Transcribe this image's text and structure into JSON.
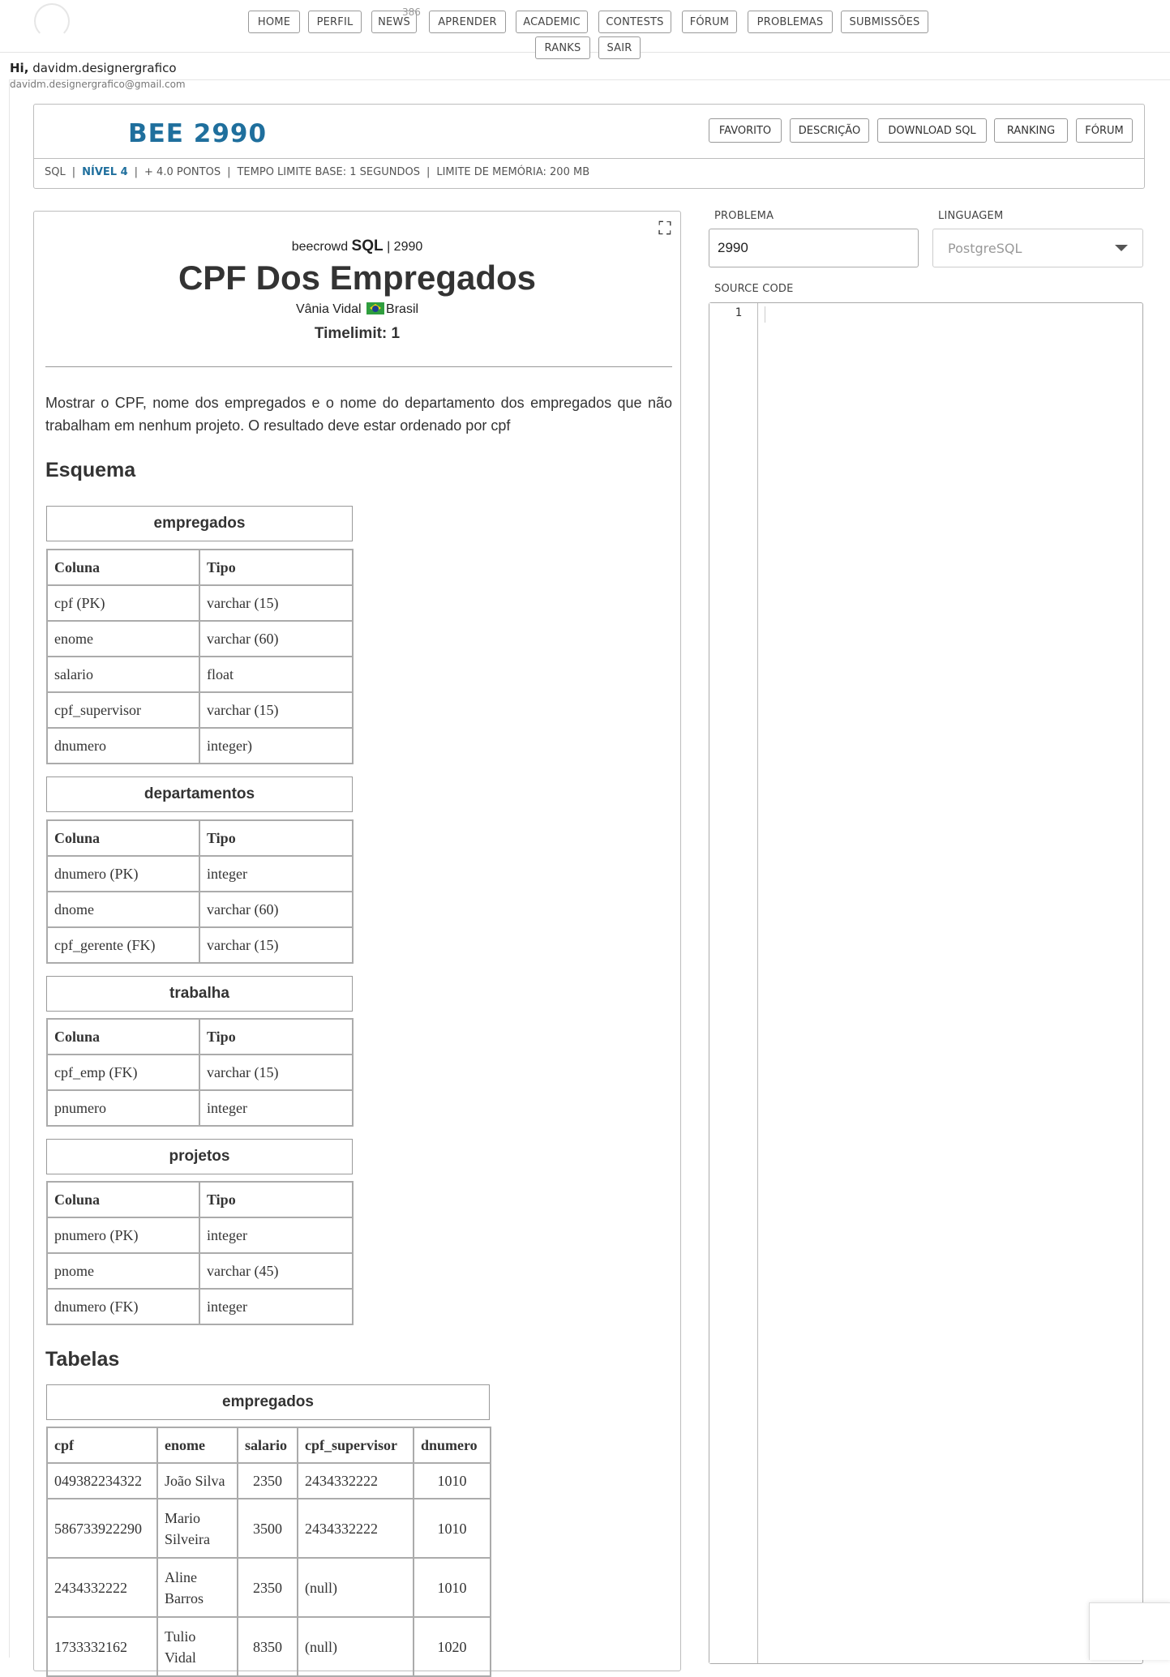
{
  "nav": {
    "items": [
      "HOME",
      "PERFIL",
      "NEWS",
      "APRENDER",
      "ACADEMIC",
      "CONTESTS",
      "FÓRUM",
      "PROBLEMAS",
      "SUBMISSÕES",
      "RANKS",
      "SAIR"
    ],
    "news_count": "386"
  },
  "user": {
    "greeting": "Hi,",
    "name": "davidm.designergrafico",
    "email": "davidm.designergrafico@gmail.com"
  },
  "header": {
    "title": "BEE 2990",
    "buttons": [
      "FAVORITO",
      "DESCRIÇÃO",
      "DOWNLOAD SQL",
      "RANKING",
      "FÓRUM"
    ],
    "meta": {
      "category": "SQL",
      "level": "NÍVEL 4",
      "points": "+ 4.0 PONTOS",
      "timelimit": "TEMPO LIMITE BASE: 1 SEGUNDOS",
      "memory": "LIMITE DE MEMÓRIA: 200 MB"
    }
  },
  "problem": {
    "source_prefix": "beecrowd",
    "source_cat": "SQL",
    "source_num": "| 2990",
    "title": "CPF Dos Empregados",
    "author": "Vânia Vidal",
    "country": "Brasil",
    "timelimit": "Timelimit: 1",
    "description": "Mostrar o CPF, nome dos empregados e o nome do departamento dos empregados que não trabalham em nenhum projeto. O resultado deve estar ordenado por cpf",
    "schema_heading": "Esquema",
    "tables_heading": "Tabelas",
    "schema_tables": [
      {
        "name": "empregados",
        "header": [
          "Coluna",
          "Tipo"
        ],
        "rows": [
          [
            "cpf (PK)",
            "varchar (15)"
          ],
          [
            "enome",
            "varchar (60)"
          ],
          [
            "salario",
            "float"
          ],
          [
            "cpf_supervisor",
            "varchar (15)"
          ],
          [
            "dnumero",
            "integer)"
          ]
        ]
      },
      {
        "name": "departamentos",
        "header": [
          "Coluna",
          "Tipo"
        ],
        "rows": [
          [
            "dnumero (PK)",
            "integer"
          ],
          [
            "dnome",
            "varchar (60)"
          ],
          [
            "cpf_gerente (FK)",
            "varchar (15)"
          ]
        ]
      },
      {
        "name": "trabalha",
        "header": [
          "Coluna",
          "Tipo"
        ],
        "rows": [
          [
            "cpf_emp (FK)",
            "varchar (15)"
          ],
          [
            "pnumero",
            "integer"
          ]
        ]
      },
      {
        "name": "projetos",
        "header": [
          "Coluna",
          "Tipo"
        ],
        "rows": [
          [
            "pnumero (PK)",
            "integer"
          ],
          [
            "pnome",
            "varchar (45)"
          ],
          [
            "dnumero (FK)",
            "integer"
          ]
        ]
      }
    ],
    "data_table": {
      "name": "empregados",
      "header": [
        "cpf",
        "enome",
        "salario",
        "cpf_supervisor",
        "dnumero"
      ],
      "rows": [
        [
          "049382234322",
          "João Silva",
          "2350",
          "2434332222",
          "1010"
        ],
        [
          "586733922290",
          "Mario Silveira",
          "3500",
          "2434332222",
          "1010"
        ],
        [
          "2434332222",
          "Aline Barros",
          "2350",
          "(null)",
          "1010"
        ],
        [
          "1733332162",
          "Tulio Vidal",
          "8350",
          "(null)",
          "1020"
        ]
      ]
    }
  },
  "editor": {
    "problem_label": "PROBLEMA",
    "problem_value": "2990",
    "language_label": "LINGUAGEM",
    "language_value": "PostgreSQL",
    "source_label": "SOURCE CODE",
    "line_number": "1"
  }
}
